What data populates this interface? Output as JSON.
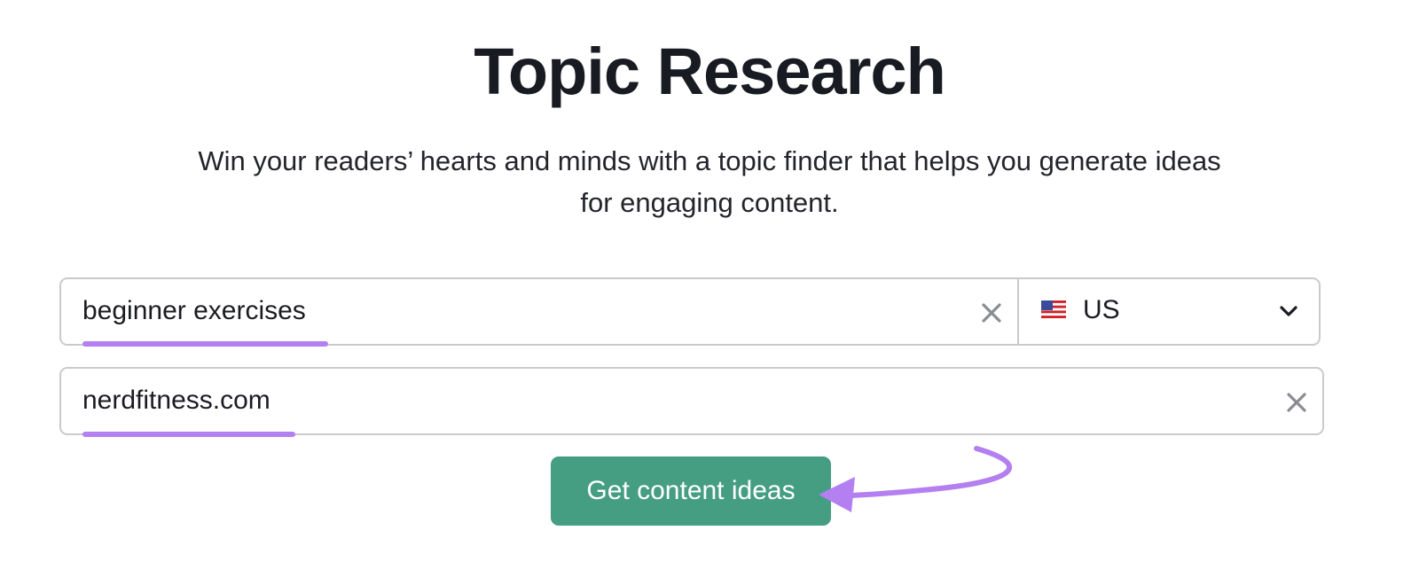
{
  "header": {
    "title": "Topic Research",
    "subtitle_line1": "Win your readers’ hearts and minds with a topic finder that helps you generate ideas",
    "subtitle_line2": "for engaging content."
  },
  "form": {
    "topic_input": {
      "value": "beginner exercises",
      "clear_icon": "close-icon"
    },
    "country_select": {
      "selected": "US",
      "flag_icon": "us-flag-icon",
      "dropdown_icon": "chevron-down-icon"
    },
    "domain_input": {
      "value": "nerdfitness.com",
      "clear_icon": "close-icon"
    },
    "submit_label": "Get content ideas"
  },
  "colors": {
    "accent_button": "#459e82",
    "highlight_annotation": "#b47ff0",
    "title_text": "#191b23",
    "border": "#c9cacd"
  }
}
